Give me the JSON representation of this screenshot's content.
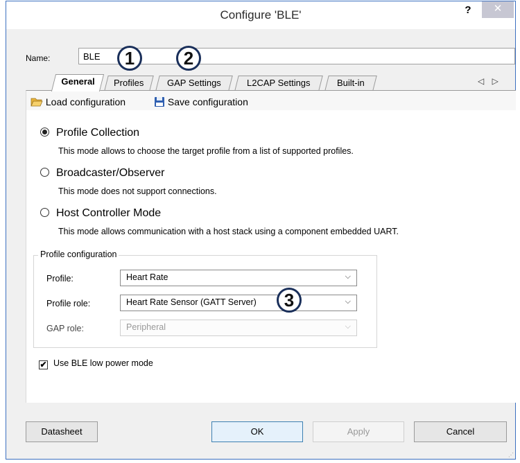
{
  "window": {
    "title": "Configure 'BLE'",
    "help_label": "?",
    "close_label": "✕"
  },
  "name": {
    "label": "Name:",
    "value": "BLE"
  },
  "callouts": [
    "1",
    "2",
    "3"
  ],
  "tabs": [
    {
      "label": "General",
      "active": true
    },
    {
      "label": "Profiles"
    },
    {
      "label": "GAP Settings"
    },
    {
      "label": "L2CAP Settings"
    },
    {
      "label": "Built-in"
    }
  ],
  "tab_scroll": "◁ ▷",
  "toolbar": {
    "load_label": "Load configuration",
    "save_label": "Save configuration",
    "load_icon": "folder-open-icon",
    "save_icon": "floppy-disk-icon"
  },
  "modes": [
    {
      "label": "Profile Collection",
      "description": "This mode allows to choose the target profile from a list of supported profiles.",
      "selected": true
    },
    {
      "label": "Broadcaster/Observer",
      "description": "This mode does not support connections.",
      "selected": false
    },
    {
      "label": "Host Controller Mode",
      "description": "This mode allows communication with a host stack using a component embedded UART.",
      "selected": false
    }
  ],
  "profile_config": {
    "title": "Profile configuration",
    "profile_label": "Profile:",
    "profile_value": "Heart Rate",
    "role_label": "Profile role:",
    "role_value": "Heart Rate Sensor (GATT Server)",
    "gap_label": "GAP role:",
    "gap_value": "Peripheral"
  },
  "low_power": {
    "label": "Use BLE low power mode",
    "checked": true,
    "mark": "✔"
  },
  "buttons": {
    "datasheet": "Datasheet",
    "ok": "OK",
    "apply": "Apply",
    "cancel": "Cancel"
  },
  "colors": {
    "accent": "#3c70c0",
    "callout_border": "#1a2f5a"
  }
}
